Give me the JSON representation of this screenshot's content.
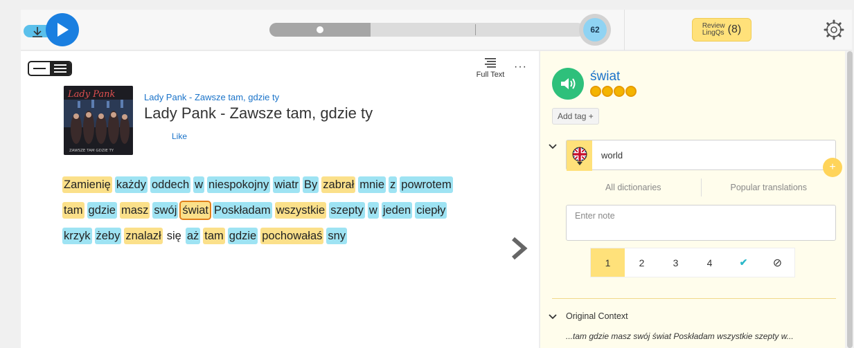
{
  "player": {
    "download_icon": "download-icon",
    "play_icon": "play-icon",
    "progress": 0.32,
    "progress_badge": "62"
  },
  "toolbar": {
    "review_label_line1": "Review",
    "review_label_line2": "LingQs",
    "review_count": "(8)",
    "settings_icon": "gear-icon"
  },
  "lesson": {
    "course": "Lady Pank - Zawsze tam, gdzie ty",
    "title": "Lady Pank - Zawsze tam, gdzie ty",
    "like": "Like",
    "full_text": "Full Text",
    "more": "···",
    "cover_band": "Lady Pank",
    "cover_caption": "ZAWSZE TAM GDZIE TY"
  },
  "text": {
    "lines": [
      [
        {
          "w": "Zamienię",
          "s": "yel"
        },
        {
          "w": "każdy",
          "s": "blue"
        },
        {
          "w": "oddech",
          "s": "blue"
        },
        {
          "w": "w",
          "s": "blue"
        },
        {
          "w": "niespokojny",
          "s": "blue"
        },
        {
          "w": "wiatr",
          "s": "blue"
        },
        {
          "w": "By",
          "s": "blue"
        },
        {
          "w": "zabrał",
          "s": "yel"
        },
        {
          "w": "mnie",
          "s": "blue"
        },
        {
          "w": "z",
          "s": "blue"
        },
        {
          "w": "powrotem",
          "s": "blue"
        }
      ],
      [
        {
          "w": "tam",
          "s": "yel"
        },
        {
          "w": "gdzie",
          "s": "blue"
        },
        {
          "w": "masz",
          "s": "yel"
        },
        {
          "w": "swój",
          "s": "blue"
        },
        {
          "w": "świat",
          "s": "sel"
        },
        {
          "w": "Poskładam",
          "s": "blue"
        },
        {
          "w": "wszystkie",
          "s": "yel"
        },
        {
          "w": "szepty",
          "s": "blue"
        },
        {
          "w": "w",
          "s": "blue"
        },
        {
          "w": "jeden",
          "s": "blue"
        },
        {
          "w": "ciepły",
          "s": "blue"
        }
      ],
      [
        {
          "w": "krzyk",
          "s": "blue"
        },
        {
          "w": "żeby",
          "s": "blue"
        },
        {
          "w": "znalazł",
          "s": "yel"
        },
        {
          "w": "się",
          "s": "plain"
        },
        {
          "w": "aż",
          "s": "blue"
        },
        {
          "w": "tam",
          "s": "yel"
        },
        {
          "w": "gdzie",
          "s": "blue"
        },
        {
          "w": "pochowałaś",
          "s": "yel"
        },
        {
          "w": "sny",
          "s": "blue"
        }
      ]
    ]
  },
  "panel": {
    "term": "świat",
    "coins": 4,
    "add_tag": "Add tag +",
    "flag": "uk-flag-icon",
    "meaning": "world",
    "plus": "+",
    "dict_tabs": [
      "All dictionaries",
      "Popular translations"
    ],
    "note_placeholder": "Enter note",
    "statuses": [
      "1",
      "2",
      "3",
      "4",
      "✔",
      "⊘"
    ],
    "active_status": 0,
    "status_colors": {
      "known": "#2bb8c9",
      "ignore": "#333333"
    },
    "context_label": "Original Context",
    "context_text": "...tam gdzie masz swój świat Poskładam wszystkie szepty w..."
  },
  "colors": {
    "accent_blue": "#1a7fe0",
    "known_blue": "#9ee3f3",
    "lingq_yellow": "#fbe08a",
    "audio_green": "#2ec07b"
  }
}
